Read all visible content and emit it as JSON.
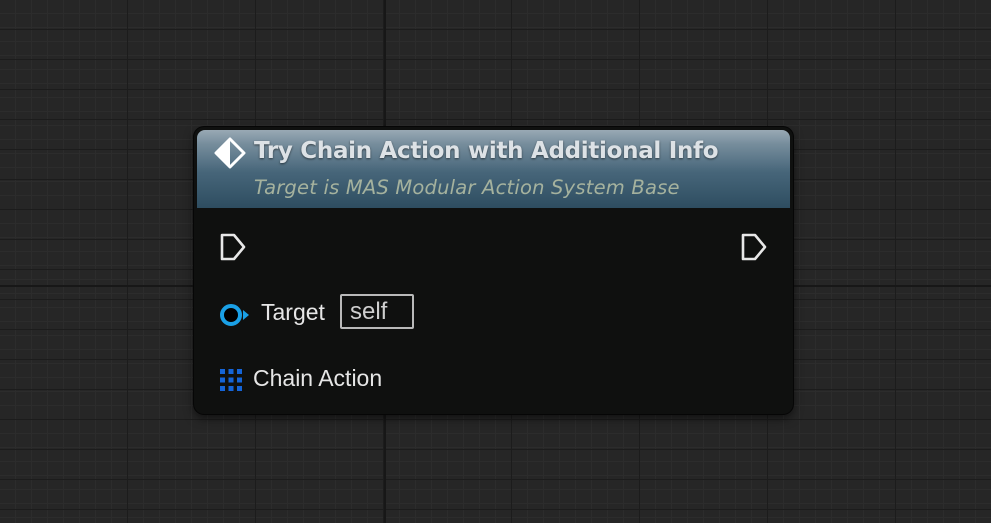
{
  "graph": {
    "node": {
      "title": "Try Chain Action with Additional Info",
      "subtitle": "Target is MAS Modular Action System Base",
      "header_colors": [
        "#90a2ae",
        "#466579",
        "#2e4d60"
      ],
      "icon": "function-icon",
      "pins": {
        "exec_in": {
          "icon": "exec-input-pin-icon"
        },
        "exec_out": {
          "icon": "exec-output-pin-icon"
        },
        "target": {
          "label": "Target",
          "value": "self",
          "icon": "object-reference-pin-icon",
          "color": "#1aa0e6"
        },
        "chain_action": {
          "label": "Chain Action",
          "icon": "struct-pin-icon",
          "color": "#1565d8"
        }
      }
    }
  }
}
